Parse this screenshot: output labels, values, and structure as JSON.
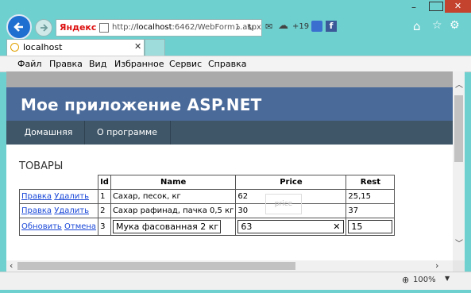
{
  "browser": {
    "url_host": "localhost",
    "url_rest": ":6462/WebForm1.aspx",
    "url_prefix": "http://",
    "brand": "Яндекс",
    "weather": "+19",
    "tab_title": "localhost",
    "zoom": "100%"
  },
  "menu": [
    "Файл",
    "Правка",
    "Вид",
    "Избранное",
    "Сервис",
    "Справка"
  ],
  "page": {
    "app_title": "Мое приложение ASP.NET",
    "nav": [
      "Домашняя",
      "О программе"
    ],
    "section_title": "Товары"
  },
  "grid": {
    "headers": [
      "Id",
      "Name",
      "Price",
      "Rest"
    ],
    "rows": [
      {
        "cmd1": "Правка",
        "cmd2": "Удалить",
        "id": "1",
        "name": "Сахар, песок, кг",
        "price": "62",
        "rest": "25,15"
      },
      {
        "cmd1": "Правка",
        "cmd2": "Удалить",
        "id": "2",
        "name": "Сахар рафинад, пачка 0,5 кг",
        "price": "30",
        "rest": "37"
      },
      {
        "cmd1": "Обновить",
        "cmd2": "Отмена",
        "id": "3",
        "name": "Мука фасованная 2 кг",
        "price": "63",
        "rest": "15"
      }
    ],
    "ghost_text": "price"
  },
  "colors": {
    "header": "#4a6a9a",
    "navbar": "#3e5668",
    "link": "#1a48d8"
  }
}
